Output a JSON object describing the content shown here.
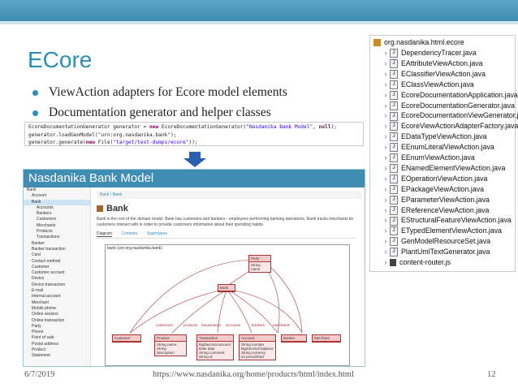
{
  "slide": {
    "title": "ECore",
    "bullets": [
      "ViewAction adapters for Ecore model elements",
      "Documentation generator and helper classes"
    ],
    "code": [
      "EcoreDocumentationGenerator generator = new EcoreDocumentationGenerator(\"Nasdanika Bank Model\", null);",
      "generator.loadGenModel(\"urn:org.nasdanika.bank\");",
      "generator.generate(new File(\"target/test-dumps/ecore\"));"
    ],
    "footer": {
      "date": "6/7/2019",
      "url": "https://www.nasdanika.org/home/products/html/index.html",
      "page": "12"
    }
  },
  "screenshot": {
    "header": "Nasdanika Bank Model",
    "tree": [
      "Bank",
      "Account",
      "Bank",
      "Accounts",
      "Bankers",
      "Customers",
      "Merchants",
      "Products",
      "Transactions",
      "Banker",
      "Banker transaction",
      "Card",
      "Contact method",
      "Customer",
      "Customer account",
      "Device",
      "Device transaction",
      "E-mail",
      "Internal account",
      "Merchant",
      "Mobile phone",
      "Online session",
      "Online transaction",
      "Party",
      "Phone",
      "Point of sale",
      "Postal address",
      "Product",
      "Statement"
    ],
    "breadcrumb": "Bank / Bank",
    "class_title": "Bank",
    "description": "Bank is the root of the domain model. Bank has customers and bankers - employees performing banking operations. Bank tracks merchants its customers interact with in order to provide customers information about their spending habits.",
    "tabs": [
      "Diagram",
      "Contents",
      "Supertypes"
    ],
    "diagram_label": "bank (urn:org.nasdanika.bank)",
    "diagram": {
      "party": {
        "title": "Party",
        "attrs": [
          "String name"
        ]
      },
      "bank": {
        "title": "Bank"
      },
      "relations": [
        "customers",
        "products",
        "transactions",
        "accounts",
        "bankers",
        "merchants"
      ],
      "classes": [
        {
          "title": "Customer",
          "attrs": []
        },
        {
          "title": "Product",
          "attrs": [
            "String name",
            "String description"
          ]
        },
        {
          "title": "Transaction",
          "attrs": [
            "BigDecimal amount",
            "Date date",
            "String comment",
            "String id"
          ]
        },
        {
          "title": "Account",
          "attrs": [
            "String number",
            "BigDecimal balance",
            "String currency",
            "int periodStart"
          ]
        },
        {
          "title": "Banker",
          "attrs": []
        },
        {
          "title": "Merchant",
          "attrs": []
        }
      ]
    }
  },
  "project": {
    "package": "org.nasdanika.html.ecore",
    "files": [
      "DependencyTracer.java",
      "EAttributeViewAction.java",
      "EClassifierViewAction.java",
      "EClassViewAction.java",
      "EcoreDocumentationApplication.java",
      "EcoreDocumentationGenerator.java",
      "EcoreDocumentationViewGenerator.java",
      "EcoreViewActionAdapterFactory.java",
      "EDataTypeViewAction.java",
      "EEnumLiteralViewAction.java",
      "EEnumViewAction.java",
      "ENamedElementViewAction.java",
      "EOperationViewAction.java",
      "EPackageViewAction.java",
      "EParameterViewAction.java",
      "EReferenceViewAction.java",
      "EStructuralFeatureViewAction.java",
      "ETypedElementViewAction.java",
      "GenModelResourceSet.java",
      "PlantUmlTextGenerator.java",
      "content-router.js"
    ]
  },
  "colors": {
    "accent": "#2d8fb8",
    "header": "#3f8db3",
    "arrow": "#2a5fb0",
    "uml": "#a33"
  }
}
